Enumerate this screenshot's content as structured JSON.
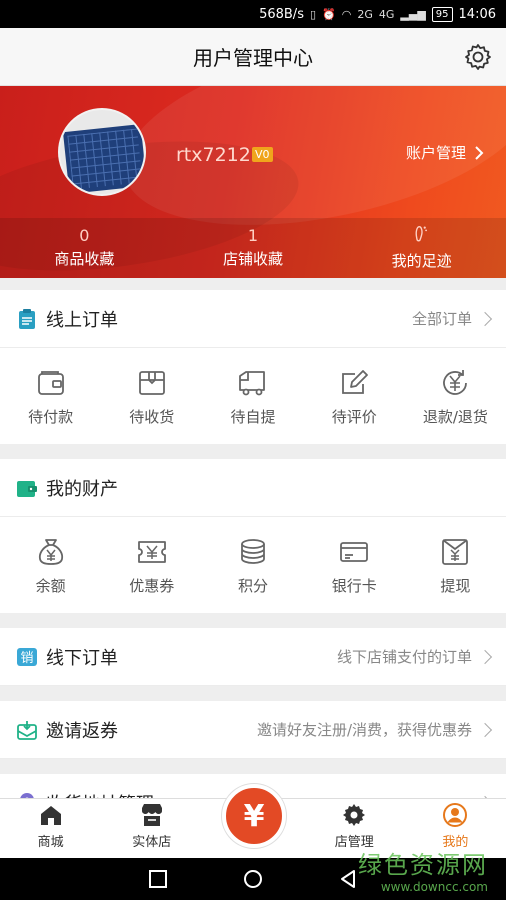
{
  "status_bar": {
    "speed": "568B/s",
    "icons": [
      "vibrate-icon",
      "alarm-icon",
      "wifi-icon",
      "signal-icon"
    ],
    "net1": "2G",
    "net2": "4G",
    "battery": "95",
    "time": "14:06"
  },
  "header": {
    "title": "用户管理中心",
    "settings_icon": "gear-icon"
  },
  "profile": {
    "username": "rtx7212",
    "vip": "V0",
    "account_label": "账户管理"
  },
  "stats": [
    {
      "value": "0",
      "label": "商品收藏"
    },
    {
      "value": "1",
      "label": "店铺收藏"
    },
    {
      "icon": "footprint-icon",
      "label": "我的足迹"
    }
  ],
  "online_orders": {
    "title": "线上订单",
    "link": "全部订单",
    "items": [
      {
        "label": "待付款",
        "icon": "wallet-icon"
      },
      {
        "label": "待收货",
        "icon": "package-icon"
      },
      {
        "label": "待自提",
        "icon": "truck-icon"
      },
      {
        "label": "待评价",
        "icon": "edit-icon"
      },
      {
        "label": "退款/退货",
        "icon": "refund-icon"
      }
    ]
  },
  "assets": {
    "title": "我的财产",
    "items": [
      {
        "label": "余额",
        "icon": "money-bag-icon"
      },
      {
        "label": "优惠券",
        "icon": "coupon-icon"
      },
      {
        "label": "积分",
        "icon": "coins-icon"
      },
      {
        "label": "银行卡",
        "icon": "bank-card-icon"
      },
      {
        "label": "提现",
        "icon": "withdraw-icon"
      }
    ]
  },
  "offline_orders": {
    "title": "线下订单",
    "hint": "线下店铺支付的订单"
  },
  "invite": {
    "title": "邀请返券",
    "hint": "邀请好友注册/消费，获得优惠券"
  },
  "address": {
    "title": "收货地址管理"
  },
  "tabbar": {
    "tabs": [
      {
        "label": "商城",
        "icon": "home-icon"
      },
      {
        "label": "实体店",
        "icon": "store-icon"
      },
      {
        "label": "",
        "icon": "yuan-icon"
      },
      {
        "label": "店管理",
        "icon": "gear-icon"
      },
      {
        "label": "我的",
        "icon": "user-icon"
      }
    ],
    "center_symbol": "¥",
    "active": "我的"
  },
  "watermark": {
    "line1": "绿色资源网",
    "line2": "www.downcc.com"
  },
  "colors": {
    "hero_red": "#de2b20",
    "accent_orange": "#e6781b",
    "icon_teal": "#2a9fc2",
    "center_button": "#e34a25"
  }
}
